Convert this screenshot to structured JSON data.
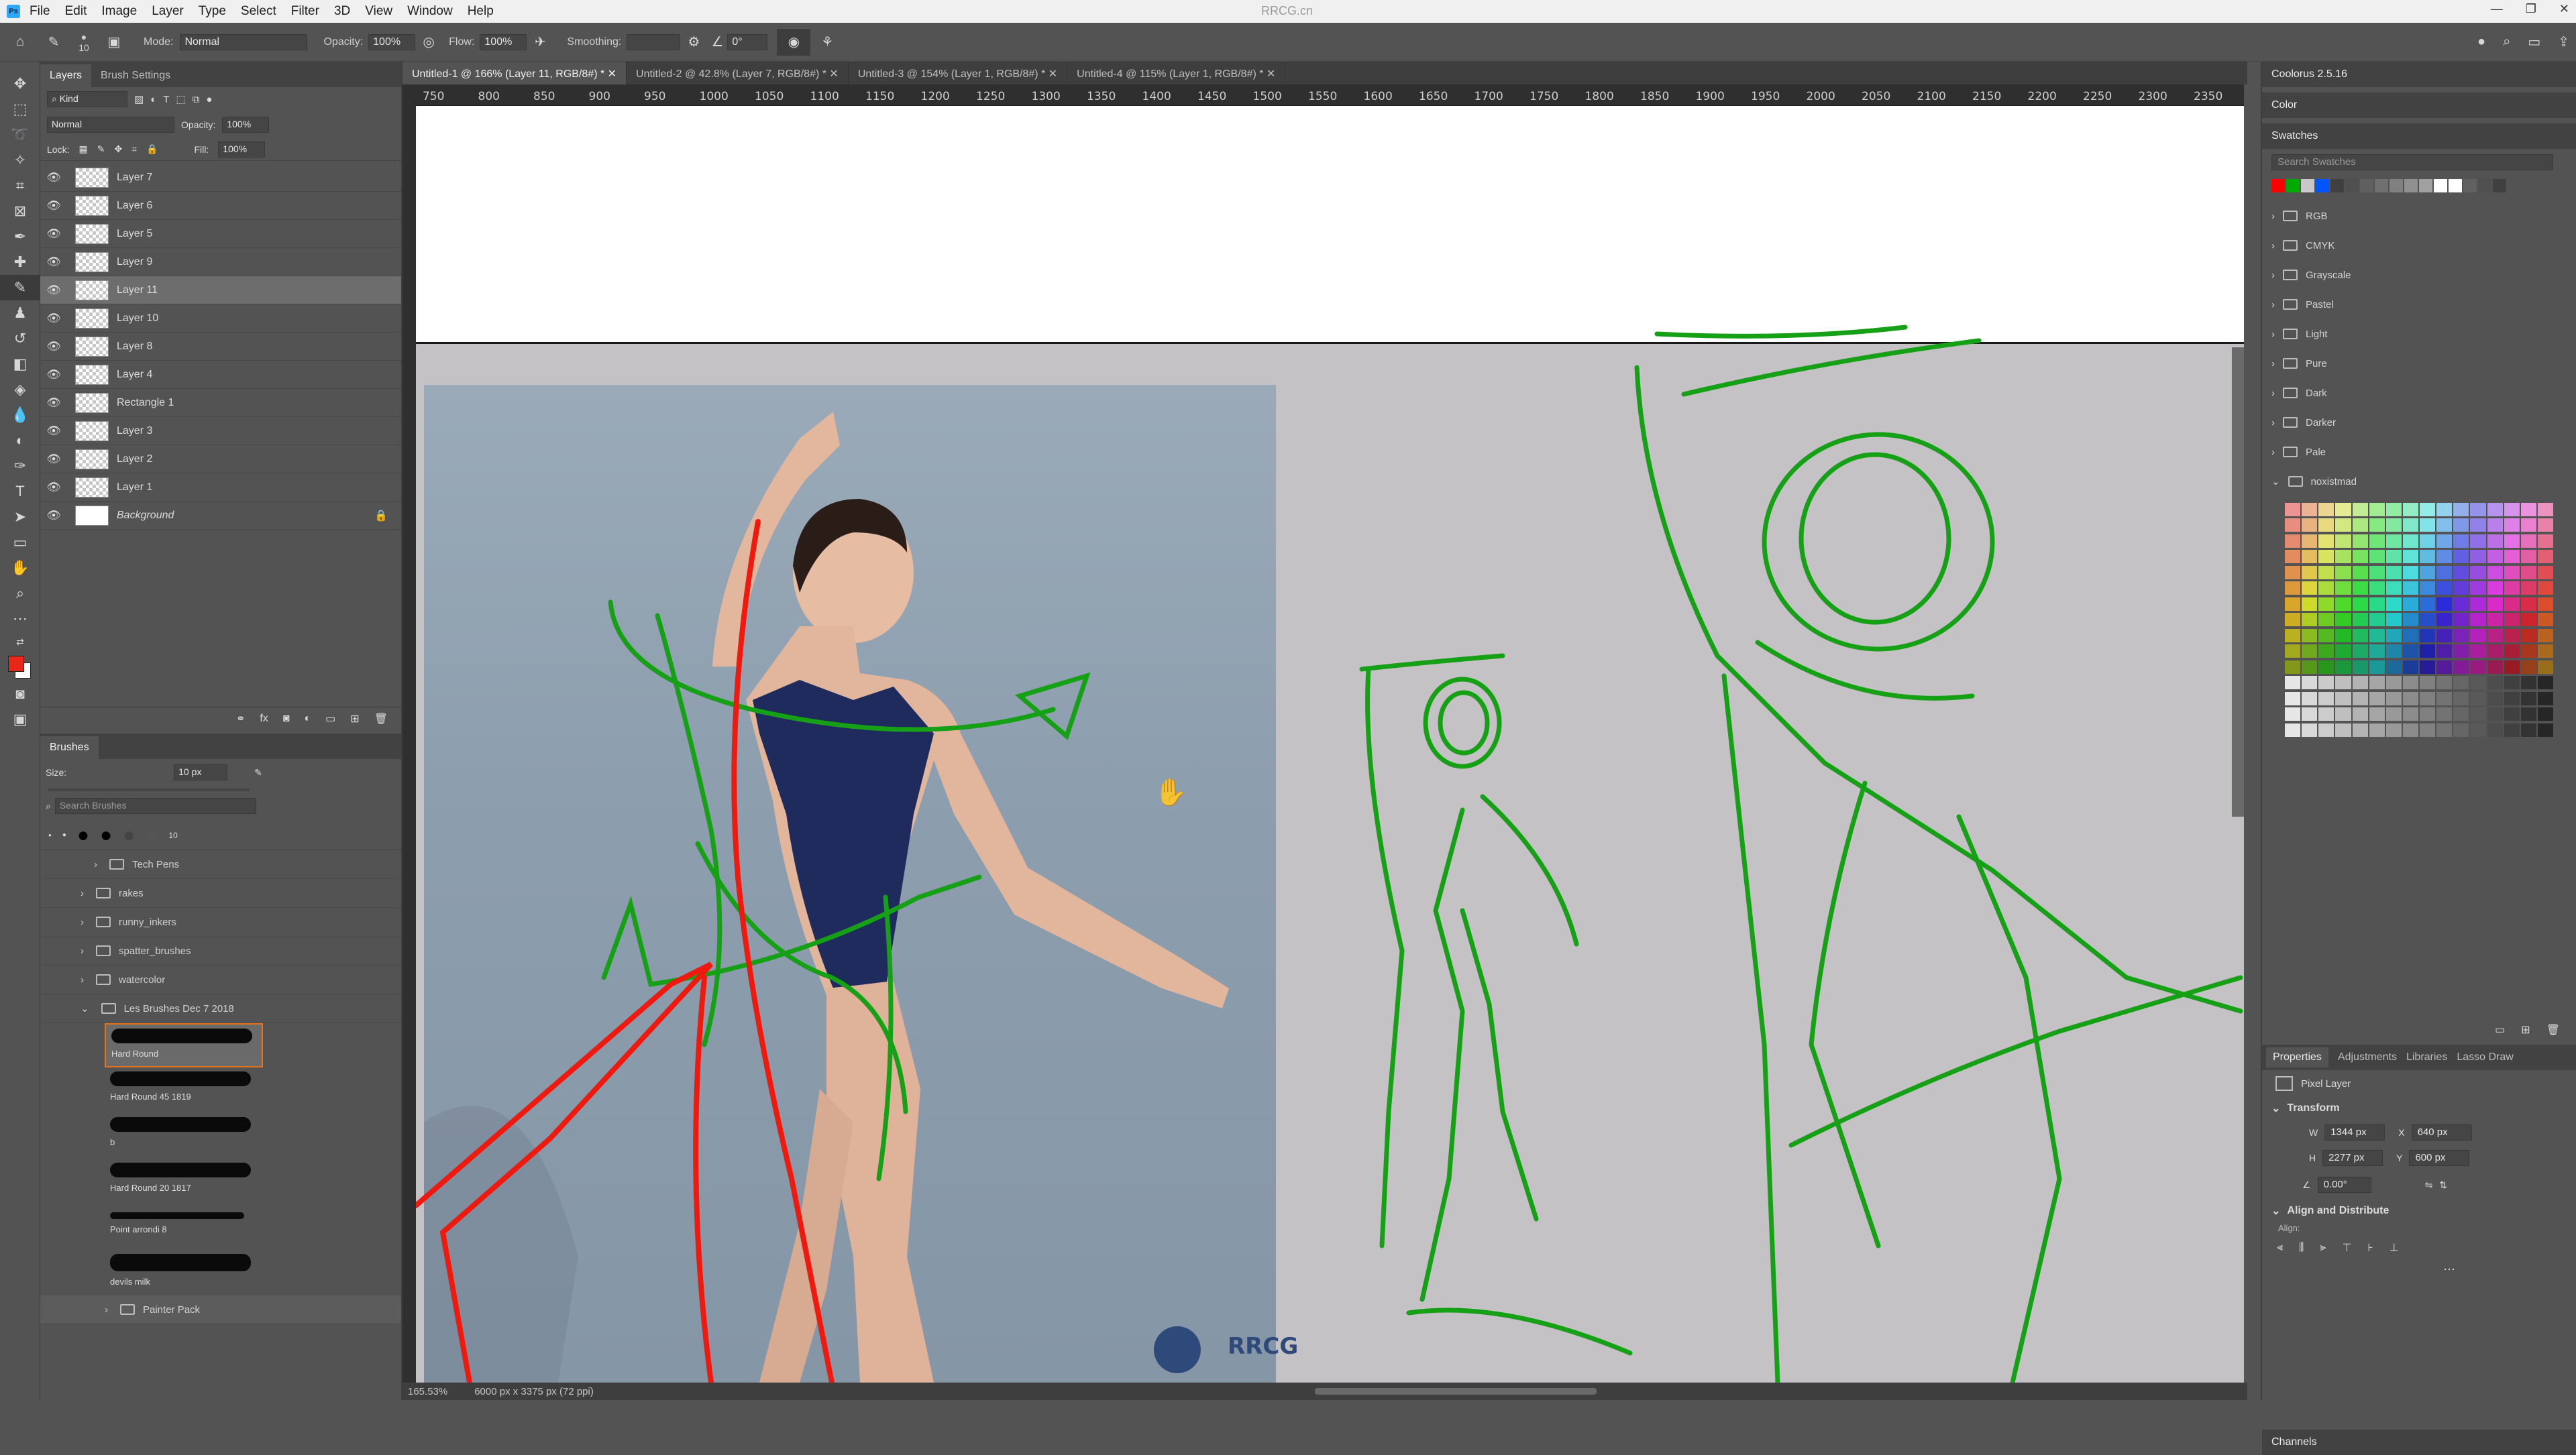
{
  "app": {
    "title": "RRCG.cn",
    "menu": [
      "File",
      "Edit",
      "Image",
      "Layer",
      "Type",
      "Select",
      "Filter",
      "3D",
      "View",
      "Window",
      "Help"
    ]
  },
  "options": {
    "brush_size": "10",
    "mode_label": "Mode:",
    "mode_value": "Normal",
    "opacity_label": "Opacity:",
    "opacity_value": "100%",
    "flow_label": "Flow:",
    "flow_value": "100%",
    "smoothing_label": "Smoothing:",
    "angle_value": "0°"
  },
  "layers_panel": {
    "tabs": [
      "Layers",
      "Brush Settings"
    ],
    "kind_label": "Kind",
    "blend_mode": "Normal",
    "opacity_label": "Opacity:",
    "opacity_value": "100%",
    "lock_label": "Lock:",
    "fill_label": "Fill:",
    "fill_value": "100%",
    "layers": [
      {
        "name": "Layer 7"
      },
      {
        "name": "Layer 6"
      },
      {
        "name": "Layer 5"
      },
      {
        "name": "Layer 9"
      },
      {
        "name": "Layer 11"
      },
      {
        "name": "Layer 10"
      },
      {
        "name": "Layer 8"
      },
      {
        "name": "Layer 4"
      },
      {
        "name": "Rectangle 1"
      },
      {
        "name": "Layer 3"
      },
      {
        "name": "Layer 2"
      },
      {
        "name": "Layer 1"
      },
      {
        "name": "Background"
      }
    ]
  },
  "brushes_panel": {
    "title": "Brushes",
    "size_label": "Size:",
    "size_value": "10 px",
    "search_placeholder": "Search Brushes",
    "preset_size": "10",
    "folders": [
      "Tech Pens",
      "rakes",
      "runny_inkers",
      "spatter_brushes",
      "watercolor",
      "Les Brushes Dec 7 2018"
    ],
    "brushes": [
      "Hard Round",
      "Hard Round 45 1819",
      "b",
      "Hard Round 20 1817",
      "Point arrondi 8",
      "devils milk"
    ],
    "bottom_folder": "Painter Pack"
  },
  "doc_tabs": [
    "Untitled-1 @ 166% (Layer 11, RGB/8#) *",
    "Untitled-2 @ 42.8% (Layer 7, RGB/8#) *",
    "Untitled-3 @ 154% (Layer 1, RGB/8#) *",
    "Untitled-4 @ 115% (Layer 1, RGB/8#) *"
  ],
  "ruler": {
    "h_ticks": [
      "750",
      "800",
      "850",
      "900",
      "950",
      "1000",
      "1050",
      "1100",
      "1150",
      "1200",
      "1250",
      "1300",
      "1350",
      "1400",
      "1450",
      "1500",
      "1550",
      "1600",
      "1650",
      "1700",
      "1750",
      "1800",
      "1850",
      "1900",
      "1950",
      "2000",
      "2050",
      "2100",
      "2150",
      "2200",
      "2250",
      "2300",
      "2350"
    ]
  },
  "status": {
    "zoom": "165.53%",
    "doc_size": "6000 px x 3375 px (72 ppi)"
  },
  "right_panel": {
    "coolorus": "Coolorus 2.5.16",
    "color_tab": "Color",
    "swatches_tab": "Swatches",
    "search_swatches": "Search Swatches",
    "swatch_colors": [
      "#ff0000",
      "#00aa00",
      "#c8c8c8",
      "#0055ff",
      "#404040",
      "#505050",
      "#606060",
      "#707070",
      "#808080",
      "#909090",
      "#a0a0a0",
      "#ffffff",
      "#ffffff",
      "#606060",
      "#505050",
      "#404040"
    ],
    "swatch_folders": [
      "RGB",
      "CMYK",
      "Grayscale",
      "Pastel",
      "Light",
      "Pure",
      "Dark",
      "Darker",
      "Pale",
      "noxistmad"
    ],
    "prop_tabs": [
      "Properties",
      "Adjustments",
      "Libraries",
      "Lasso Draw"
    ],
    "pixel_layer": "Pixel Layer",
    "transform_label": "Transform",
    "w_label": "W",
    "w_value": "1344 px",
    "x_label": "X",
    "x_value": "640 px",
    "h_label": "H",
    "h_value": "2277 px",
    "y_label": "Y",
    "y_value": "600 px",
    "angle_value": "0.00°",
    "align_label": "Align and Distribute",
    "align_sub": "Align:",
    "channels_tab": "Channels"
  },
  "colors": {
    "foreground": "#e8261a",
    "sketch_green": "#16a016",
    "sketch_red": "#ee1a10"
  },
  "watermark": "RRCG"
}
